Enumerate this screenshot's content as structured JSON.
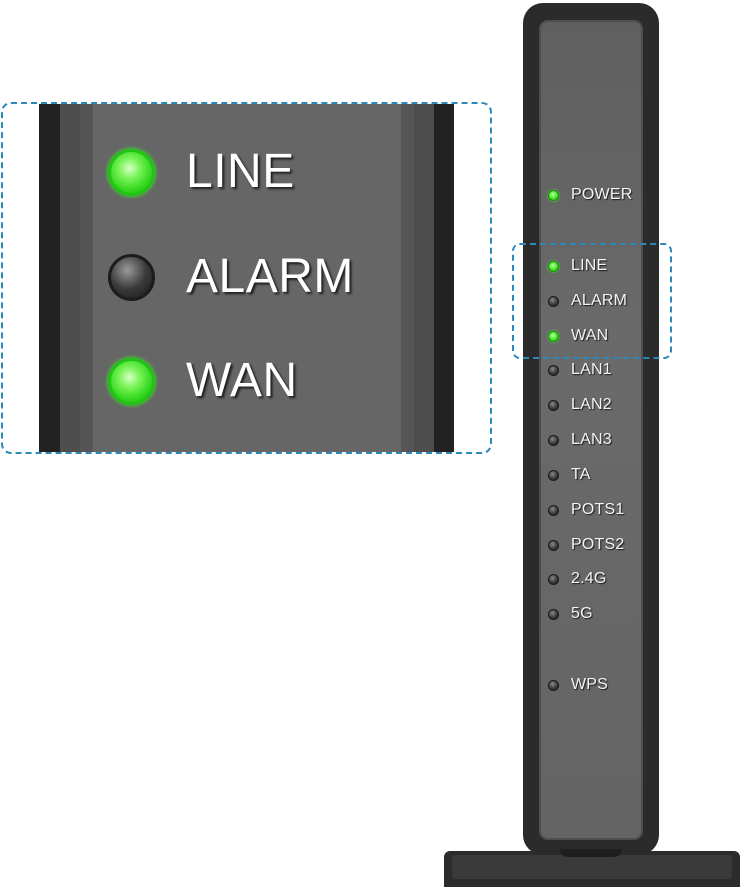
{
  "router": {
    "leds": [
      {
        "label": "POWER",
        "state": "on"
      },
      {
        "label": "LINE",
        "state": "on"
      },
      {
        "label": "ALARM",
        "state": "off"
      },
      {
        "label": "WAN",
        "state": "on"
      },
      {
        "label": "LAN1",
        "state": "off"
      },
      {
        "label": "LAN2",
        "state": "off"
      },
      {
        "label": "LAN3",
        "state": "off"
      },
      {
        "label": "TA",
        "state": "off"
      },
      {
        "label": "POTS1",
        "state": "off"
      },
      {
        "label": "POTS2",
        "state": "off"
      },
      {
        "label": "2.4G",
        "state": "off"
      },
      {
        "label": "5G",
        "state": "off"
      },
      {
        "label": "WPS",
        "state": "off"
      }
    ]
  },
  "zoom": {
    "leds": [
      {
        "label": "LINE",
        "state": "on"
      },
      {
        "label": "ALARM",
        "state": "off"
      },
      {
        "label": "WAN",
        "state": "on"
      }
    ]
  },
  "colors": {
    "led_on": "#2fd31a",
    "led_off": "#2a2a2a",
    "highlight": "#2b89b9",
    "router_body": "#2b2b2b",
    "router_face": "#666666"
  }
}
